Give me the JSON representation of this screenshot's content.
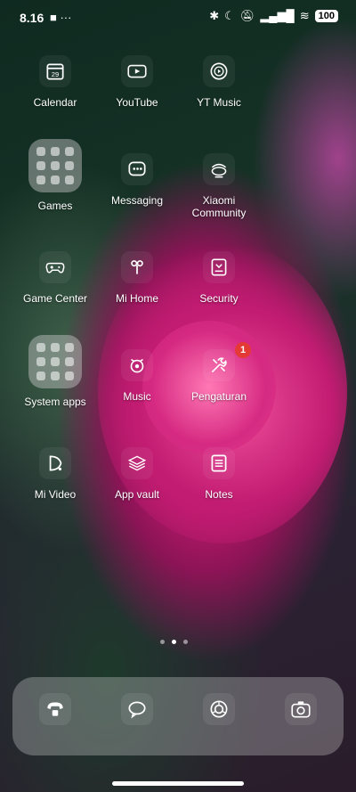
{
  "status": {
    "time": "8.16",
    "left_icons": "■ ···",
    "battery": "100"
  },
  "apps": {
    "calendar": {
      "label": "Calendar",
      "icon_text": "29"
    },
    "youtube": {
      "label": "YouTube"
    },
    "yt_music": {
      "label": "YT Music"
    },
    "games": {
      "label": "Games"
    },
    "messaging": {
      "label": "Messaging"
    },
    "xiaomi_community": {
      "label": "Xiaomi Community"
    },
    "game_center": {
      "label": "Game Center"
    },
    "mi_home": {
      "label": "Mi Home"
    },
    "security": {
      "label": "Security"
    },
    "system_apps": {
      "label": "System apps"
    },
    "music": {
      "label": "Music"
    },
    "pengaturan": {
      "label": "Pengaturan",
      "badge": "1"
    },
    "mi_video": {
      "label": "Mi Video"
    },
    "app_vault": {
      "label": "App vault"
    },
    "notes": {
      "label": "Notes"
    }
  },
  "page_indicator": {
    "pages": 3,
    "active_page": 2
  },
  "dock": [
    "phone-icon",
    "message-icon",
    "browser-icon",
    "camera-icon"
  ],
  "colors": {
    "badge": "#e53935",
    "rose": "#c81e72"
  }
}
